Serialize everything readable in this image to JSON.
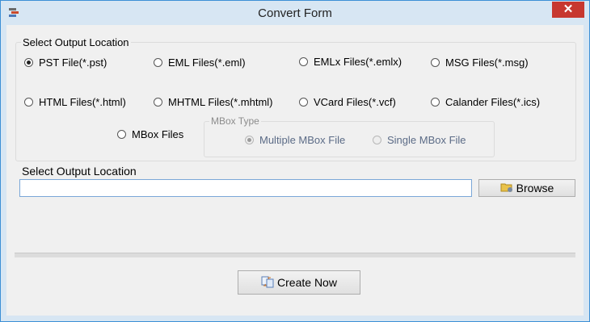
{
  "window": {
    "title": "Convert Form",
    "close_glyph": "✕",
    "accent": "#3c8fd6",
    "close_color": "#c7372f"
  },
  "options_group": {
    "legend": "Select Output Location",
    "options": [
      {
        "label": "PST File(*.pst)",
        "checked": true
      },
      {
        "label": "EML Files(*.eml)",
        "checked": false
      },
      {
        "label": "EMLx Files(*.emlx)",
        "checked": false
      },
      {
        "label": "MSG Files(*.msg)",
        "checked": false
      },
      {
        "label": "HTML Files(*.html)",
        "checked": false
      },
      {
        "label": "MHTML Files(*.mhtml)",
        "checked": false
      },
      {
        "label": "VCard Files(*.vcf)",
        "checked": false
      },
      {
        "label": "Calander Files(*.ics)",
        "checked": false
      },
      {
        "label": "MBox Files",
        "checked": false
      }
    ],
    "mbox_type": {
      "legend": "MBox Type",
      "options": [
        {
          "label": "Multiple MBox File",
          "checked": true
        },
        {
          "label": "Single MBox File",
          "checked": false
        }
      ]
    }
  },
  "output": {
    "label": "Select Output Location",
    "value": "",
    "browse_label": "Browse"
  },
  "actions": {
    "create_label": "Create Now"
  },
  "icons": {
    "app": "app-icon",
    "browse": "folder-icon",
    "create": "convert-icon"
  }
}
